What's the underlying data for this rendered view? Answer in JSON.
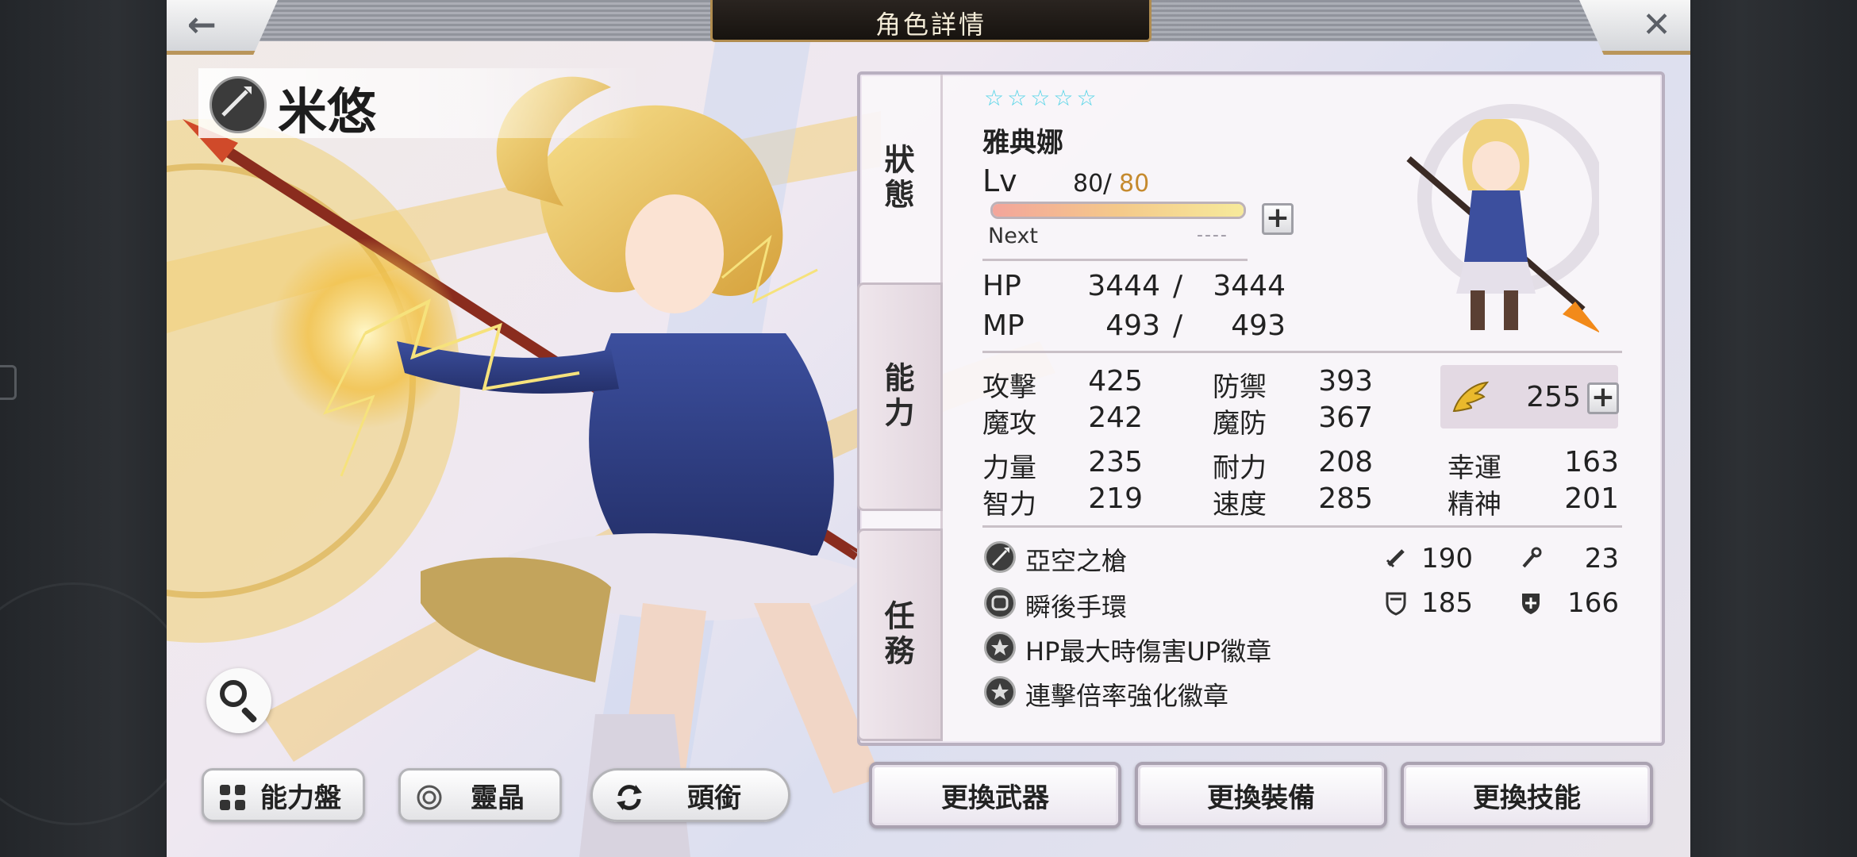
{
  "header": {
    "title": "角色詳情",
    "back_icon": "arrow-left-icon",
    "close_icon": "close-icon"
  },
  "character": {
    "name": "米悠",
    "class_icon": "spear-icon"
  },
  "tabs": [
    {
      "label": "狀態"
    },
    {
      "label": "能力"
    },
    {
      "label": "任務"
    }
  ],
  "status": {
    "stars": 5,
    "unit_name": "雅典娜",
    "lv_label": "Lv",
    "lv_current": "80",
    "lv_sep": "/",
    "lv_max": "80",
    "exp_fill": 1.0,
    "next_label": "Next",
    "next_value": "----",
    "hp_label": "HP",
    "hp_current": "3444",
    "hp_sep": "/",
    "hp_max": "3444",
    "mp_label": "MP",
    "mp_current": "493",
    "mp_sep": "/",
    "mp_max": "493",
    "stats": {
      "atk_label": "攻擊",
      "atk": "425",
      "def_label": "防禦",
      "def": "393",
      "matk_label": "魔攻",
      "matk": "242",
      "mdef_label": "魔防",
      "mdef": "367",
      "str_label": "力量",
      "str": "235",
      "vit_label": "耐力",
      "vit": "208",
      "luk_label": "幸運",
      "luk": "163",
      "int_label": "智力",
      "int": "219",
      "spd_label": "速度",
      "spd": "285",
      "spi_label": "精神",
      "spi": "201"
    },
    "points": {
      "icon": "wing-icon",
      "value": "255"
    },
    "equipment": [
      {
        "icon": "spear-icon",
        "name": "亞空之槍"
      },
      {
        "icon": "bracelet-icon",
        "name": "瞬後手環"
      },
      {
        "icon": "badge-icon",
        "name": "HP最大時傷害UP徽章"
      },
      {
        "icon": "badge-icon",
        "name": "連擊倍率強化徽章"
      }
    ],
    "equip_stats": {
      "sword_value": "190",
      "staff_value": "23",
      "shield_value": "185",
      "mshield_value": "166"
    }
  },
  "bottom_left": [
    {
      "label": "能力盤",
      "icon": "grid-icon"
    },
    {
      "label": "靈晶",
      "icon": "crystal-icon"
    },
    {
      "label": "頭銜",
      "icon": "refresh-icon"
    }
  ],
  "actions": [
    {
      "label": "更換武器"
    },
    {
      "label": "更換裝備"
    },
    {
      "label": "更換技能"
    }
  ],
  "colors": {
    "star": "#4fd3e6",
    "lv_max": "#c58a2e",
    "title_gold": "#b08c4f"
  }
}
